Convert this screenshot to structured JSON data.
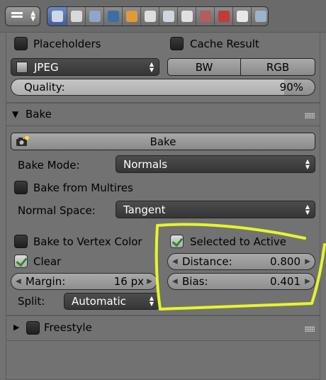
{
  "header": {
    "editor_menu_icon": "properties-editor-icon",
    "tabs": [
      {
        "name": "render-tab",
        "icon": "camera-icon",
        "color": "#cfd8e6",
        "active": true
      },
      {
        "name": "render-layers-tab",
        "icon": "layers-icon",
        "color": "#d9d9d9",
        "active": false
      },
      {
        "name": "scene-tab",
        "icon": "scene-icon",
        "color": "#8fa6c9",
        "active": false
      },
      {
        "name": "world-tab",
        "icon": "world-icon",
        "color": "#3c6ea0",
        "active": false
      },
      {
        "name": "object-tab",
        "icon": "object-cube-icon",
        "color": "#e09a3a",
        "active": false
      },
      {
        "name": "constraints-tab",
        "icon": "constraint-link-icon",
        "color": "#dedede",
        "active": false
      },
      {
        "name": "modifiers-tab",
        "icon": "wrench-icon",
        "color": "#cfd6df",
        "active": false
      },
      {
        "name": "data-tab",
        "icon": "vertex-triangle-icon",
        "color": "#e0e0e0",
        "active": false
      },
      {
        "name": "material-tab",
        "icon": "material-sphere-icon",
        "color": "#b05e5e",
        "active": false
      },
      {
        "name": "texture-tab",
        "icon": "texture-checker-icon",
        "color": "#c23a3a",
        "active": false
      },
      {
        "name": "particles-tab",
        "icon": "particles-icon",
        "color": "#e8e8e8",
        "active": false
      },
      {
        "name": "physics-tab",
        "icon": "physics-icon",
        "color": "#9db3cc",
        "active": false
      }
    ]
  },
  "output": {
    "placeholders_label": "Placeholders",
    "placeholders_checked": false,
    "cache_result_label": "Cache Result",
    "cache_result_checked": false,
    "format_value": "JPEG",
    "format_icon": "image-file-icon",
    "bw_label": "BW",
    "rgb_label": "RGB",
    "quality_label": "Quality:",
    "quality_value": "90%",
    "quality_fraction": 0.9
  },
  "bake": {
    "title": "Bake",
    "button_label": "Bake",
    "mode_label": "Bake Mode:",
    "mode_value": "Normals",
    "from_multires_label": "Bake from Multires",
    "from_multires_checked": false,
    "normal_space_label": "Normal Space:",
    "normal_space_value": "Tangent",
    "to_vertex_color_label": "Bake to Vertex Color",
    "to_vertex_color_checked": false,
    "clear_label": "Clear",
    "clear_checked": true,
    "margin_label": "Margin:",
    "margin_value": "16 px",
    "split_label": "Split:",
    "split_value": "Automatic",
    "selected_to_active_label": "Selected to Active",
    "selected_to_active_checked": true,
    "distance_label": "Distance:",
    "distance_value": "0.800",
    "bias_label": "Bias:",
    "bias_value": "0.401",
    "highlight_color": "#e6f52a"
  },
  "freestyle": {
    "title": "Freestyle",
    "checked": false
  }
}
